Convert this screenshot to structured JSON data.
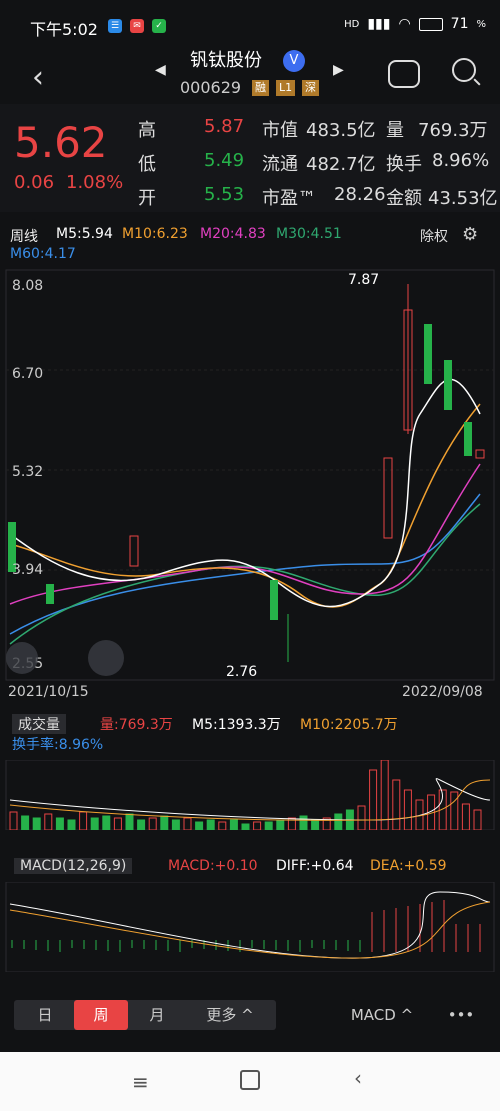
{
  "status": {
    "time": "下午5:02",
    "battery": "71",
    "net": "HD"
  },
  "header": {
    "name": "钒钛股份",
    "code": "000629",
    "tags": [
      "融",
      "L1",
      "深"
    ]
  },
  "quote": {
    "price": "5.62",
    "change": "0.06",
    "pct": "1.08%",
    "rows": [
      {
        "l1": "高",
        "v1": "5.87",
        "l2": "市值",
        "v2": "483.5亿",
        "l3": "量",
        "v3": "769.3万"
      },
      {
        "l1": "低",
        "v1": "5.49",
        "l2": "流通",
        "v2": "482.7亿",
        "l3": "换手",
        "v3": "8.96%"
      },
      {
        "l1": "开",
        "v1": "5.53",
        "l2": "市盈™",
        "v2": "28.26",
        "l3": "金额",
        "v3": "43.53亿"
      }
    ]
  },
  "ma": {
    "period": "周线",
    "m5": "M5:5.94",
    "m10": "M10:6.23",
    "m20": "M20:4.83",
    "m30": "M30:4.51",
    "m60": "M60:4.17",
    "adj": "除权"
  },
  "axis": {
    "y_top": "8.08",
    "y_mid": "6.70",
    "y_low": "5.32",
    "y_4": "3.94",
    "y_bottom": "2.55",
    "x_start": "2021/10/15",
    "x_end": "2022/09/08",
    "max_label": "7.87",
    "min_label": "2.76"
  },
  "vol": {
    "title": "成交量",
    "vol": "量:769.3万",
    "m5": "M5:1393.3万",
    "m10": "M10:2205.7万",
    "turn": "换手率:8.96%"
  },
  "macd": {
    "title": "MACD(12,26,9)",
    "macd": "MACD:+0.10",
    "diff": "DIFF:+0.64",
    "dea": "DEA:+0.59"
  },
  "tabs": {
    "day": "日",
    "week": "周",
    "month": "月",
    "more": "更多 ^",
    "macd": "MACD ^",
    "dots": "•••"
  },
  "colors": {
    "up": "#e84444",
    "down": "#26b24a",
    "m5": "#ffffff",
    "m10": "#f0a030",
    "m20": "#e040c0",
    "m30": "#2fa870",
    "m60": "#3a8ee8"
  },
  "chart_data": {
    "type": "candlestick",
    "x_range": [
      "2021/10/15",
      "2022/09/08"
    ],
    "ylim": [
      2.55,
      8.08
    ],
    "high": 7.87,
    "low": 2.76
  }
}
